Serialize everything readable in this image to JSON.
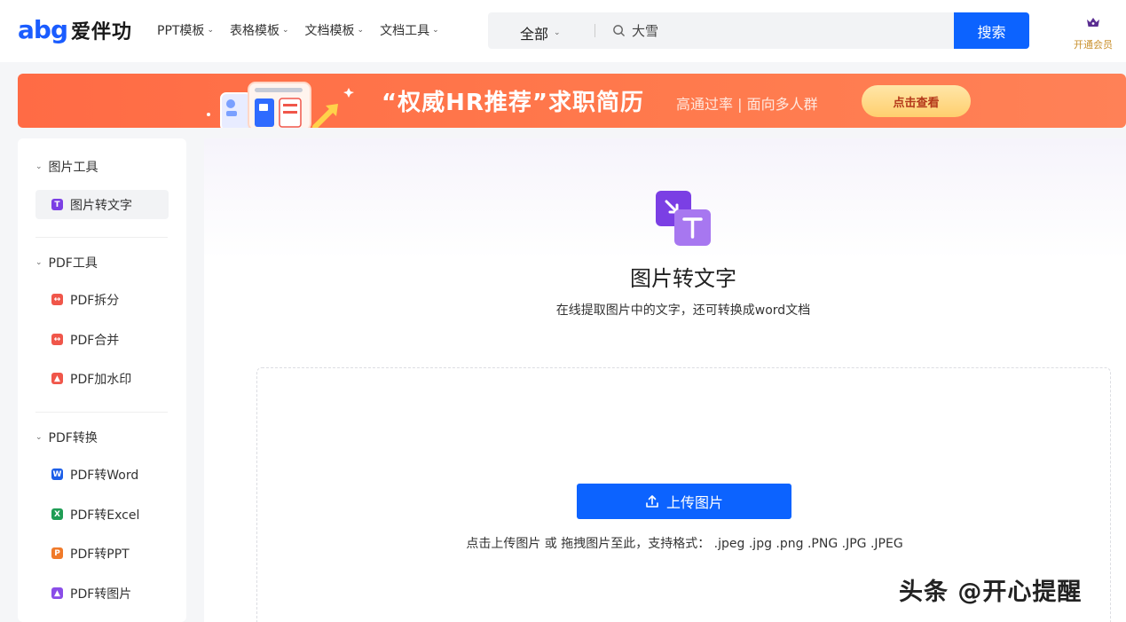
{
  "logo": {
    "mark": "abg",
    "text": "爱伴功"
  },
  "nav": [
    {
      "label": "PPT模板"
    },
    {
      "label": "表格模板"
    },
    {
      "label": "文档模板"
    },
    {
      "label": "文档工具"
    }
  ],
  "search": {
    "category": "全部",
    "value": "大雪",
    "button": "搜索"
  },
  "vip": {
    "label": "开通会员"
  },
  "banner": {
    "title": "“权威HR推荐”求职简历",
    "subtitle": "高通过率 | 面向多人群",
    "button": "点击查看"
  },
  "sidebar": {
    "groups": [
      {
        "title": "图片工具",
        "items": [
          {
            "label": "图片转文字",
            "icon": "T",
            "color": "#7b3fe4"
          }
        ]
      },
      {
        "title": "PDF工具",
        "items": [
          {
            "label": "PDF拆分",
            "icon": "",
            "color": "#f0564a"
          },
          {
            "label": "PDF合并",
            "icon": "",
            "color": "#f0564a"
          },
          {
            "label": "PDF加水印",
            "icon": "",
            "color": "#f0564a"
          }
        ]
      },
      {
        "title": "PDF转换",
        "items": [
          {
            "label": "PDF转Word",
            "icon": "W",
            "color": "#1d5fe8"
          },
          {
            "label": "PDF转Excel",
            "icon": "X",
            "color": "#1f9d55"
          },
          {
            "label": "PDF转PPT",
            "icon": "P",
            "color": "#f07a2a"
          },
          {
            "label": "PDF转图片",
            "icon": "",
            "color": "#8a4de8"
          }
        ]
      }
    ]
  },
  "main": {
    "title": "图片转文字",
    "description": "在线提取图片中的文字，还可转换成word文档",
    "upload_button": "上传图片",
    "upload_hint": "点击上传图片 或 拖拽图片至此，支持格式： .jpeg .jpg .png .PNG .JPG .JPEG"
  },
  "watermark": "头条 @开心提醒"
}
